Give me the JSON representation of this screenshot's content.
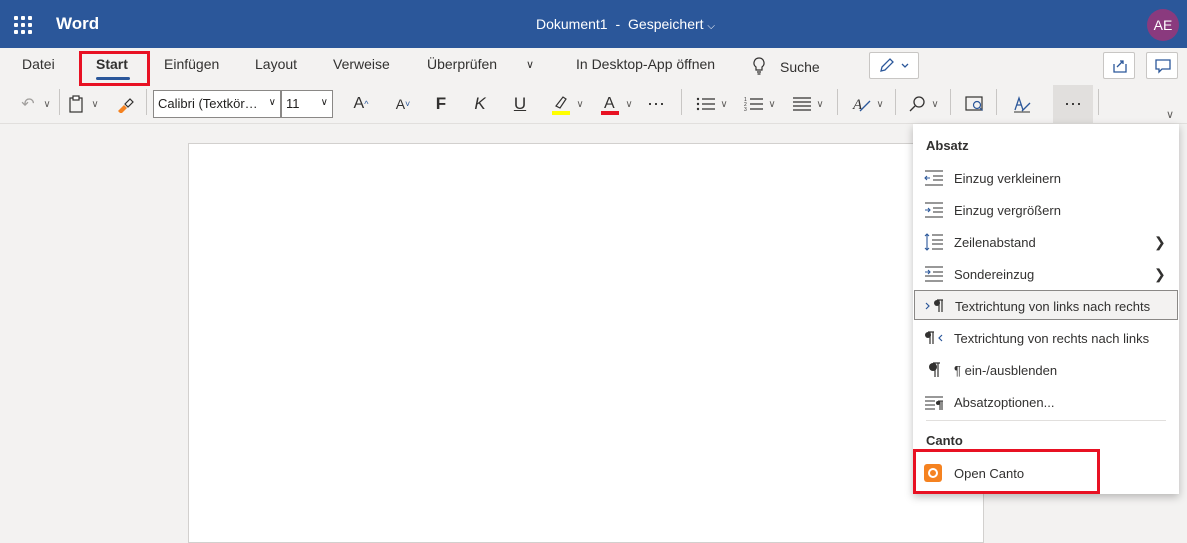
{
  "titlebar": {
    "app_name": "Word",
    "document": "Dokument1",
    "separator": "-",
    "status": "Gespeichert",
    "user_initials": "AE",
    "colors": {
      "bar": "#2b579a",
      "avatar": "#8a3a7e"
    }
  },
  "ribbon": {
    "tabs": [
      {
        "label": "Datei"
      },
      {
        "label": "Start"
      },
      {
        "label": "Einfügen"
      },
      {
        "label": "Layout"
      },
      {
        "label": "Verweise"
      },
      {
        "label": "Überprüfen"
      },
      {
        "label": "In Desktop-App öffnen"
      }
    ],
    "search_label": "Suche",
    "font_name": "Calibri (Textkör…",
    "font_size": "11",
    "bold_glyph": "F",
    "italic_glyph": "K",
    "underline_glyph": "U",
    "highlight_color": "#ffff00",
    "font_color": "#e81123"
  },
  "menu": {
    "section_absatz": "Absatz",
    "items": [
      {
        "label": "Einzug verkleinern",
        "icon": "decrease-indent-icon"
      },
      {
        "label": "Einzug vergrößern",
        "icon": "increase-indent-icon"
      },
      {
        "label": "Zeilenabstand",
        "icon": "line-spacing-icon",
        "submenu": true
      },
      {
        "label": "Sondereinzug",
        "icon": "special-indent-icon",
        "submenu": true
      },
      {
        "label": "Textrichtung von links nach rechts",
        "icon": "ltr-icon"
      },
      {
        "label": "Textrichtung von rechts nach links",
        "icon": "rtl-icon"
      },
      {
        "label": "¶ ein-/ausblenden",
        "icon": "pilcrow-icon"
      },
      {
        "label": "Absatzoptionen...",
        "icon": "paragraph-options-icon"
      }
    ],
    "section_canto": "Canto",
    "canto_item": "Open Canto",
    "colors": {
      "canto": "#f58220"
    }
  },
  "highlight_box_color": "#e81123"
}
